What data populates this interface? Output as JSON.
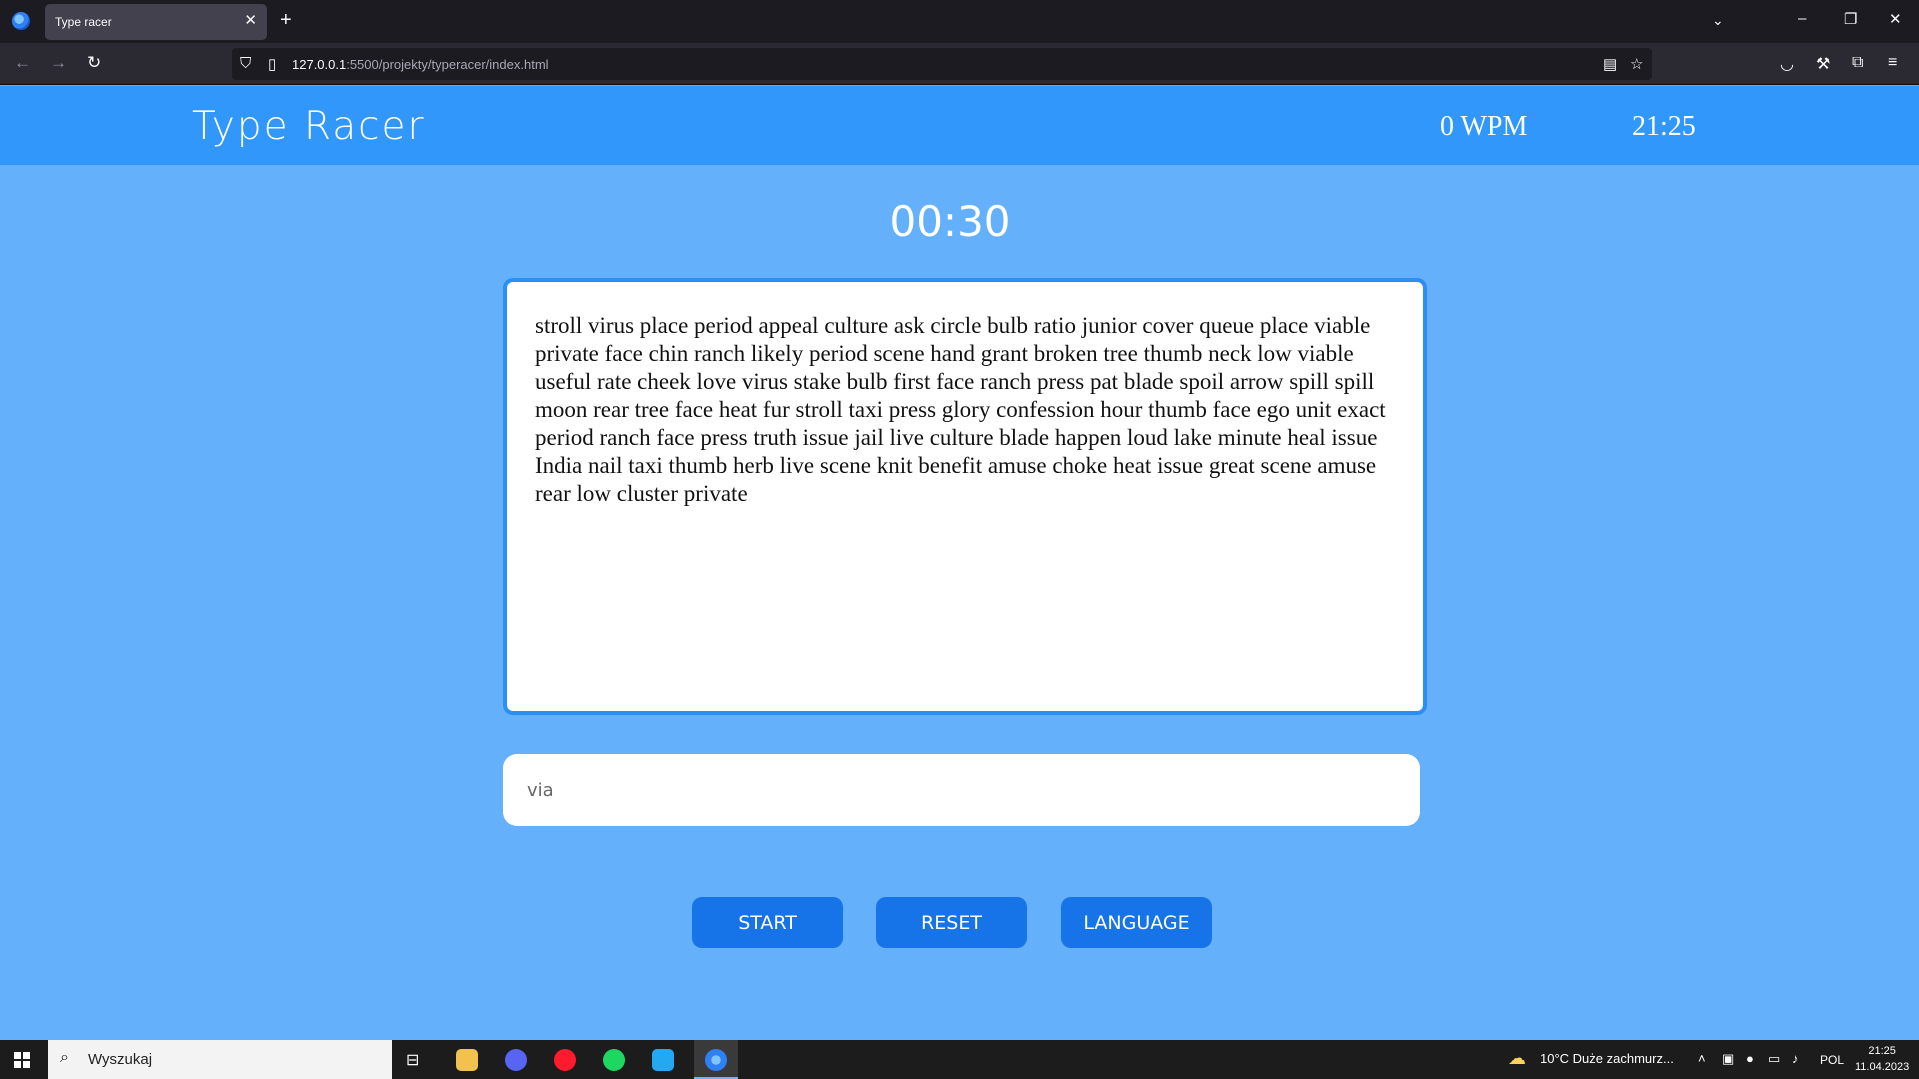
{
  "browser": {
    "tab_title": "Type racer",
    "url_host": "127.0.0.1",
    "url_path": ":5500/projekty/typeracer/index.html"
  },
  "header": {
    "title": "Type Racer",
    "wpm": "0 WPM",
    "clock": "21:25"
  },
  "game": {
    "timer": "00:30",
    "text": "stroll virus place period appeal culture ask circle bulb ratio junior cover queue place viable private face chin ranch likely period scene hand grant broken tree thumb neck low viable useful rate cheek love virus stake bulb first face ranch press pat blade spoil arrow spill spill moon rear tree face heat fur stroll taxi press glory confession hour thumb face ego unit exact period ranch face press truth issue jail live culture blade happen loud lake minute heal issue India nail taxi thumb herb live scene knit benefit amuse choke heat issue great scene amuse rear low cluster private",
    "input_value": "via"
  },
  "buttons": {
    "start": "START",
    "reset": "RESET",
    "language": "LANGUAGE"
  },
  "taskbar": {
    "search_label": "Wyszukaj",
    "weather": "10°C  Duże zachmurz...",
    "lang": "POL",
    "time": "21:25",
    "date": "11.04.2023"
  },
  "colors": {
    "page_bg": "#64b0fb",
    "header_bg": "#3197fa",
    "button_bg": "#1673e8",
    "text_box_border": "#2a8ff5"
  }
}
